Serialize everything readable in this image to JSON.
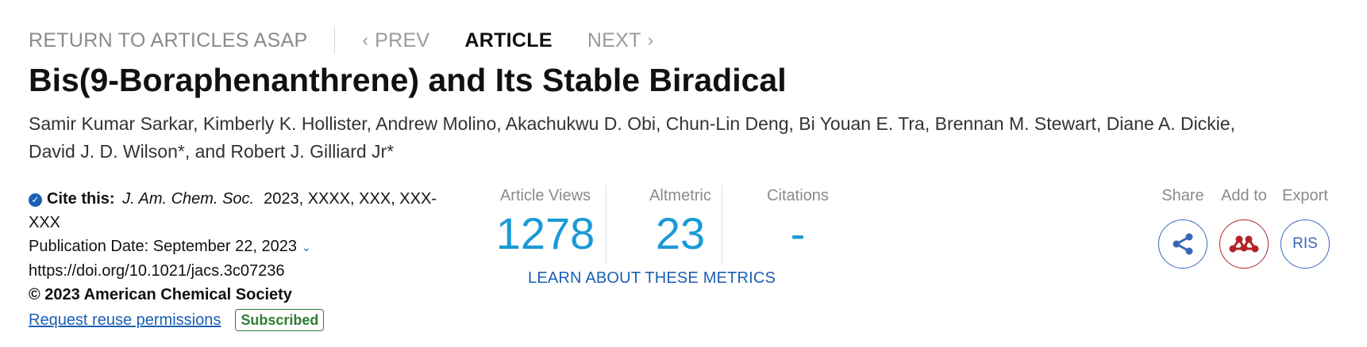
{
  "nav": {
    "return_label": "RETURN TO ARTICLES ASAP",
    "prev_label": "PREV",
    "current_label": "ARTICLE",
    "next_label": "NEXT"
  },
  "article": {
    "title": "Bis(9-Boraphenanthrene) and Its Stable Biradical",
    "authors": [
      "Samir Kumar Sarkar",
      "Kimberly K. Hollister",
      "Andrew Molino",
      "Akachukwu D. Obi",
      "Chun-Lin Deng",
      "Bi Youan E. Tra",
      "Brennan M. Stewart",
      "Diane A. Dickie",
      "David J. D. Wilson*",
      "Robert J. Gilliard Jr*"
    ]
  },
  "citation": {
    "cite_label": "Cite this:",
    "journal": "J. Am. Chem. Soc.",
    "details": "2023, XXXX, XXX, XXX-XXX",
    "publication_date": "Publication Date: September 22, 2023",
    "doi": "https://doi.org/10.1021/jacs.3c07236",
    "copyright": "© 2023 American Chemical Society",
    "reuse_link": "Request reuse permissions",
    "badge": "Subscribed"
  },
  "metrics": {
    "views_label": "Article Views",
    "views_value": "1278",
    "altmetric_label": "Altmetric",
    "altmetric_value": "23",
    "citations_label": "Citations",
    "citations_value": "-",
    "learn_link": "LEARN ABOUT THESE METRICS"
  },
  "actions": {
    "share_label": "Share",
    "add_label": "Add to",
    "export_label": "Export",
    "ris_label": "RIS",
    "share_icon": "share-icon",
    "add_icon": "mendeley-icon"
  },
  "colors": {
    "link": "#1a5fb4",
    "metric_value": "#1a9ad6",
    "badge": "#2e7d32",
    "mendeley": "#b32424"
  }
}
